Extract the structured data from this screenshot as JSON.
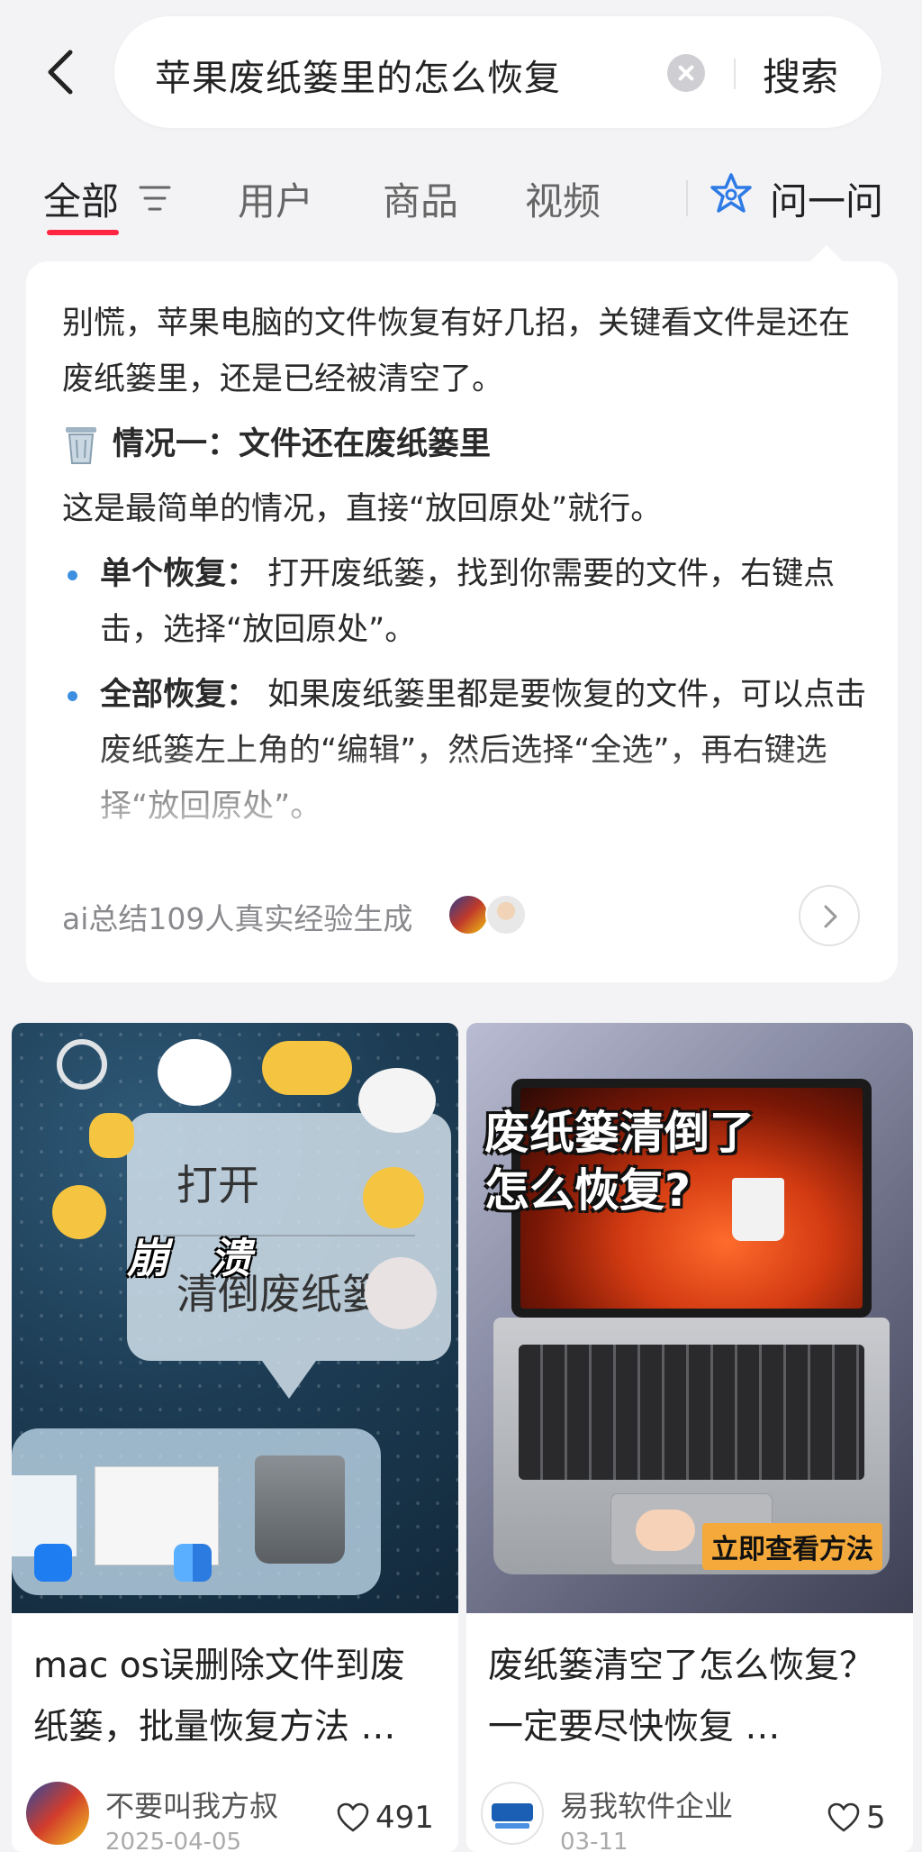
{
  "header": {
    "search_query": "苹果废纸篓里的怎么恢复",
    "search_button": "搜索"
  },
  "tabs": {
    "items": [
      "全部",
      "用户",
      "商品",
      "视频"
    ],
    "active": "全部",
    "ask_label": "问一问",
    "accent_color": "#ff2442"
  },
  "ai_card": {
    "intro": "别慌，苹果电脑的文件恢复有好几招，关键看文件是还在废纸篓里，还是已经被清空了。",
    "section_title": "情况一：文件还在废纸篓里",
    "section_desc": "这是最简单的情况，直接“放回原处”就行。",
    "bullets": [
      {
        "label": "单个恢复：",
        "text": "打开废纸篓，找到你需要的文件，右键点击，选择“放回原处”。"
      },
      {
        "label": "全部恢复：",
        "text": "如果废纸篓里都是要恢复的文件，可以点击废纸篓左上角的“编辑”，然后选择“全选”，再右键选择“放回原处”。"
      }
    ],
    "footer": "ai总结109人真实经验生成"
  },
  "feed": [
    {
      "title": "mac os误删除文件到废纸篓，批量恢复方法 …",
      "author": "不要叫我方叔",
      "date": "2025-04-05",
      "likes": "491",
      "thumb_text": {
        "open": "打开",
        "empty": "清倒废纸篓",
        "boom": "崩　溃"
      }
    },
    {
      "title": "废纸篓清空了怎么恢复？一定要尽快恢复 …",
      "author": "易我软件企业",
      "date": "03-11",
      "likes": "5",
      "thumb_text": {
        "headline_1": "废纸篓清倒了",
        "headline_2": "怎么恢复?",
        "cta": "立即查看方法"
      }
    }
  ]
}
